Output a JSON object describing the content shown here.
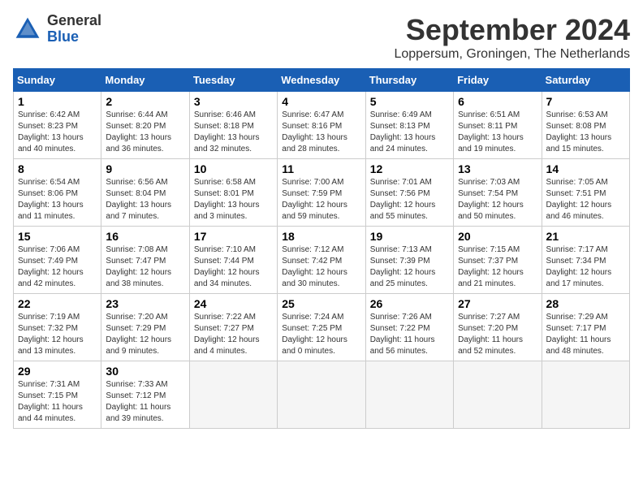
{
  "header": {
    "logo_line1": "General",
    "logo_line2": "Blue",
    "month": "September 2024",
    "location": "Loppersum, Groningen, The Netherlands"
  },
  "weekdays": [
    "Sunday",
    "Monday",
    "Tuesday",
    "Wednesday",
    "Thursday",
    "Friday",
    "Saturday"
  ],
  "weeks": [
    [
      {
        "day": "1",
        "info": "Sunrise: 6:42 AM\nSunset: 8:23 PM\nDaylight: 13 hours\nand 40 minutes."
      },
      {
        "day": "2",
        "info": "Sunrise: 6:44 AM\nSunset: 8:20 PM\nDaylight: 13 hours\nand 36 minutes."
      },
      {
        "day": "3",
        "info": "Sunrise: 6:46 AM\nSunset: 8:18 PM\nDaylight: 13 hours\nand 32 minutes."
      },
      {
        "day": "4",
        "info": "Sunrise: 6:47 AM\nSunset: 8:16 PM\nDaylight: 13 hours\nand 28 minutes."
      },
      {
        "day": "5",
        "info": "Sunrise: 6:49 AM\nSunset: 8:13 PM\nDaylight: 13 hours\nand 24 minutes."
      },
      {
        "day": "6",
        "info": "Sunrise: 6:51 AM\nSunset: 8:11 PM\nDaylight: 13 hours\nand 19 minutes."
      },
      {
        "day": "7",
        "info": "Sunrise: 6:53 AM\nSunset: 8:08 PM\nDaylight: 13 hours\nand 15 minutes."
      }
    ],
    [
      {
        "day": "8",
        "info": "Sunrise: 6:54 AM\nSunset: 8:06 PM\nDaylight: 13 hours\nand 11 minutes."
      },
      {
        "day": "9",
        "info": "Sunrise: 6:56 AM\nSunset: 8:04 PM\nDaylight: 13 hours\nand 7 minutes."
      },
      {
        "day": "10",
        "info": "Sunrise: 6:58 AM\nSunset: 8:01 PM\nDaylight: 13 hours\nand 3 minutes."
      },
      {
        "day": "11",
        "info": "Sunrise: 7:00 AM\nSunset: 7:59 PM\nDaylight: 12 hours\nand 59 minutes."
      },
      {
        "day": "12",
        "info": "Sunrise: 7:01 AM\nSunset: 7:56 PM\nDaylight: 12 hours\nand 55 minutes."
      },
      {
        "day": "13",
        "info": "Sunrise: 7:03 AM\nSunset: 7:54 PM\nDaylight: 12 hours\nand 50 minutes."
      },
      {
        "day": "14",
        "info": "Sunrise: 7:05 AM\nSunset: 7:51 PM\nDaylight: 12 hours\nand 46 minutes."
      }
    ],
    [
      {
        "day": "15",
        "info": "Sunrise: 7:06 AM\nSunset: 7:49 PM\nDaylight: 12 hours\nand 42 minutes."
      },
      {
        "day": "16",
        "info": "Sunrise: 7:08 AM\nSunset: 7:47 PM\nDaylight: 12 hours\nand 38 minutes."
      },
      {
        "day": "17",
        "info": "Sunrise: 7:10 AM\nSunset: 7:44 PM\nDaylight: 12 hours\nand 34 minutes."
      },
      {
        "day": "18",
        "info": "Sunrise: 7:12 AM\nSunset: 7:42 PM\nDaylight: 12 hours\nand 30 minutes."
      },
      {
        "day": "19",
        "info": "Sunrise: 7:13 AM\nSunset: 7:39 PM\nDaylight: 12 hours\nand 25 minutes."
      },
      {
        "day": "20",
        "info": "Sunrise: 7:15 AM\nSunset: 7:37 PM\nDaylight: 12 hours\nand 21 minutes."
      },
      {
        "day": "21",
        "info": "Sunrise: 7:17 AM\nSunset: 7:34 PM\nDaylight: 12 hours\nand 17 minutes."
      }
    ],
    [
      {
        "day": "22",
        "info": "Sunrise: 7:19 AM\nSunset: 7:32 PM\nDaylight: 12 hours\nand 13 minutes."
      },
      {
        "day": "23",
        "info": "Sunrise: 7:20 AM\nSunset: 7:29 PM\nDaylight: 12 hours\nand 9 minutes."
      },
      {
        "day": "24",
        "info": "Sunrise: 7:22 AM\nSunset: 7:27 PM\nDaylight: 12 hours\nand 4 minutes."
      },
      {
        "day": "25",
        "info": "Sunrise: 7:24 AM\nSunset: 7:25 PM\nDaylight: 12 hours\nand 0 minutes."
      },
      {
        "day": "26",
        "info": "Sunrise: 7:26 AM\nSunset: 7:22 PM\nDaylight: 11 hours\nand 56 minutes."
      },
      {
        "day": "27",
        "info": "Sunrise: 7:27 AM\nSunset: 7:20 PM\nDaylight: 11 hours\nand 52 minutes."
      },
      {
        "day": "28",
        "info": "Sunrise: 7:29 AM\nSunset: 7:17 PM\nDaylight: 11 hours\nand 48 minutes."
      }
    ],
    [
      {
        "day": "29",
        "info": "Sunrise: 7:31 AM\nSunset: 7:15 PM\nDaylight: 11 hours\nand 44 minutes."
      },
      {
        "day": "30",
        "info": "Sunrise: 7:33 AM\nSunset: 7:12 PM\nDaylight: 11 hours\nand 39 minutes."
      },
      {
        "day": "",
        "info": ""
      },
      {
        "day": "",
        "info": ""
      },
      {
        "day": "",
        "info": ""
      },
      {
        "day": "",
        "info": ""
      },
      {
        "day": "",
        "info": ""
      }
    ]
  ]
}
